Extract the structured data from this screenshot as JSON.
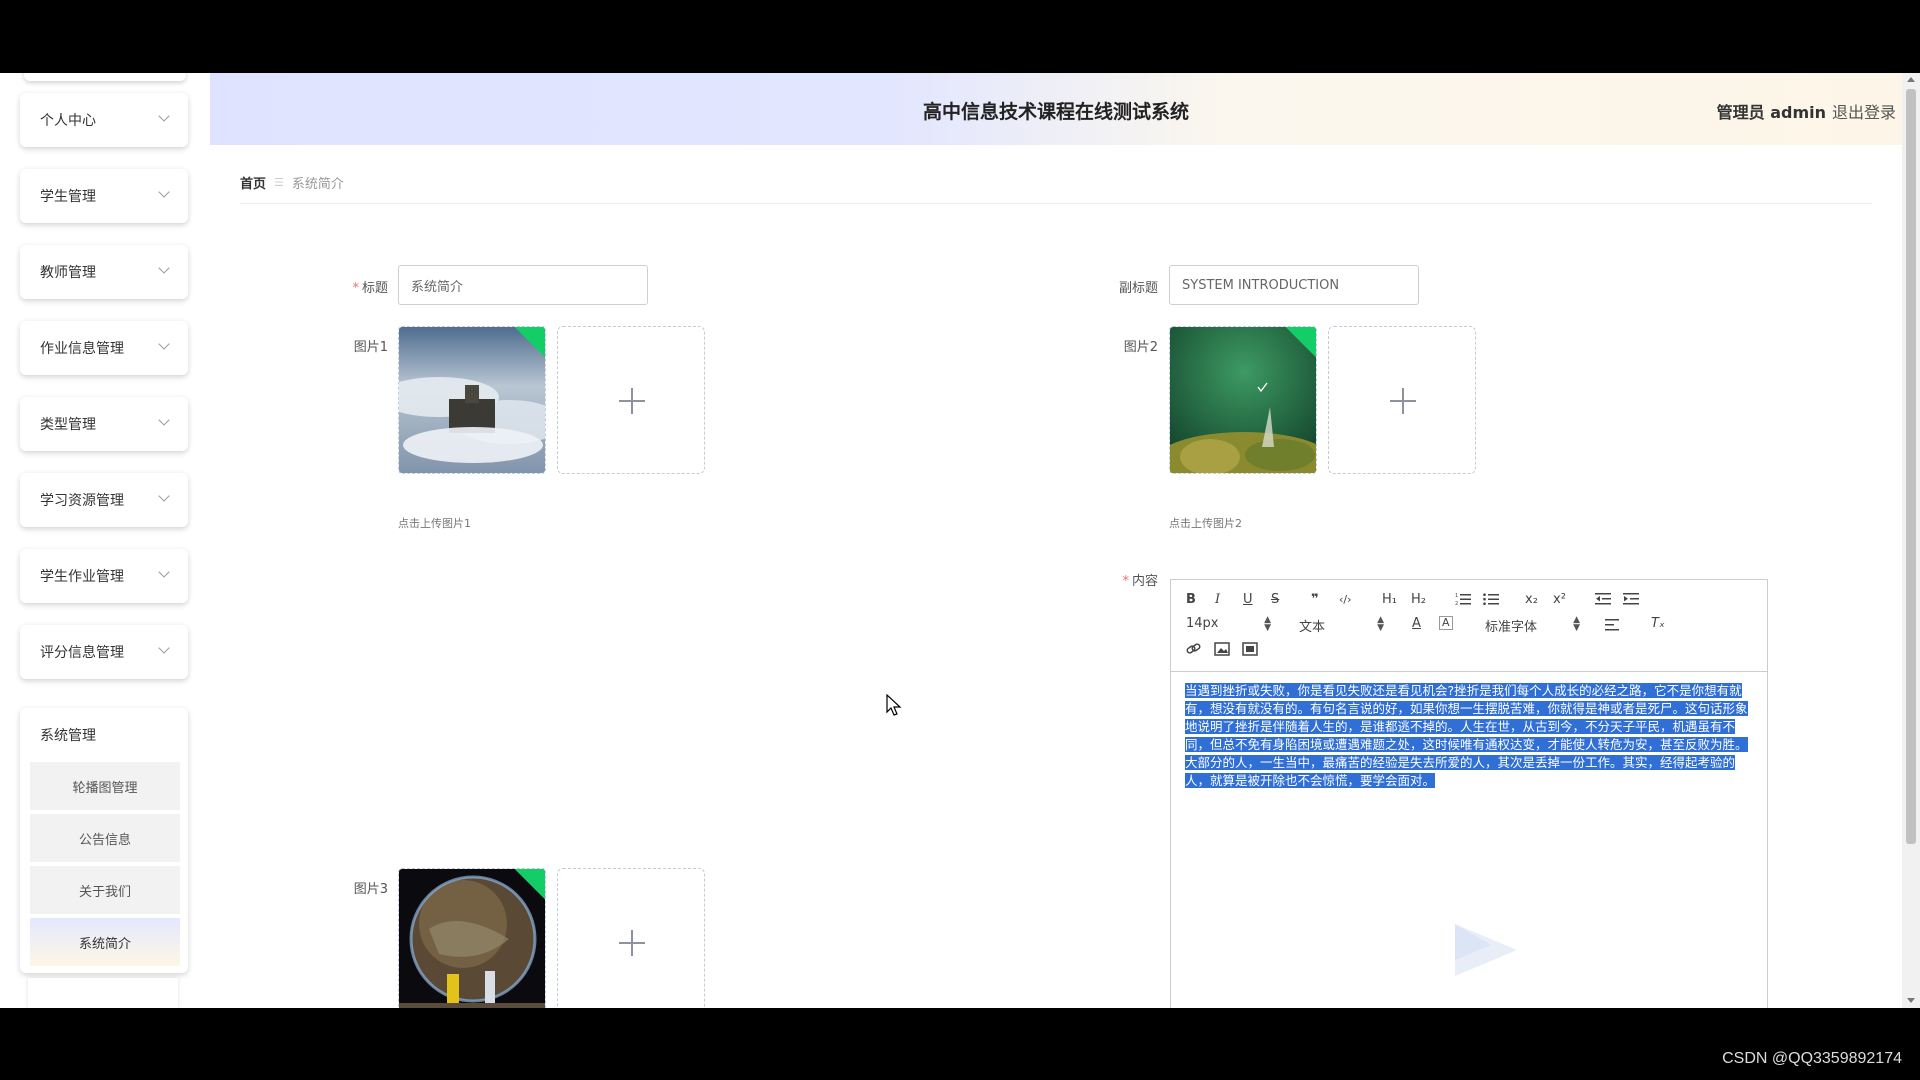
{
  "app": {
    "title": "高中信息技术课程在线测试系统",
    "user_label": "管理员 admin",
    "logout_label": "退出登录"
  },
  "sidebar": {
    "items": [
      {
        "label": "个人中心"
      },
      {
        "label": "学生管理"
      },
      {
        "label": "教师管理"
      },
      {
        "label": "作业信息管理"
      },
      {
        "label": "类型管理"
      },
      {
        "label": "学习资源管理"
      },
      {
        "label": "学生作业管理"
      },
      {
        "label": "评分信息管理"
      }
    ],
    "expanded": {
      "label": "系统管理",
      "children": [
        {
          "label": "轮播图管理"
        },
        {
          "label": "公告信息"
        },
        {
          "label": "关于我们"
        },
        {
          "label": "系统简介",
          "active": true
        }
      ]
    }
  },
  "breadcrumb": {
    "home": "首页",
    "separator": "☰",
    "current": "系统简介"
  },
  "form": {
    "title_label": "标题",
    "title_value": "系统简介",
    "subtitle_label": "副标题",
    "subtitle_value": "SYSTEM INTRODUCTION",
    "pic1_label": "图片1",
    "pic1_hint": "点击上传图片1",
    "pic2_label": "图片2",
    "pic2_hint": "点击上传图片2",
    "pic3_label": "图片3",
    "content_label": "内容",
    "required_mark": "*"
  },
  "editor": {
    "toolbar": {
      "bold": "B",
      "italic": "I",
      "underline": "U",
      "strike": "S",
      "quote": "❞",
      "code": "‹/›",
      "h1": "H₁",
      "h2": "H₂",
      "sub": "x₂",
      "sup": "x²",
      "size": "14px",
      "header": "文本",
      "font": "标准字体",
      "color": "A",
      "clean": "Tₓ"
    },
    "content": "当遇到挫折或失败，你是看见失败还是看见机会?挫折是我们每个人成长的必经之路，它不是你想有就有，想没有就没有的。有句名言说的好，如果你想一生摆脱苦难，你就得是神或者是死尸。这句话形象地说明了挫折是伴随着人生的，是谁都逃不掉的。人生在世，从古到今，不分天子平民，机遇虽有不同，但总不免有身陷困境或遭遇难题之处，这时候唯有通权达变，才能使人转危为安，甚至反败为胜。大部分的人，一生当中，最痛苦的经验是失去所爱的人，其次是丢掉一份工作。其实，经得起考验的人，就算是被开除也不会惊慌，要学会面对。"
  },
  "watermark": "CSDN @QQ3359892174",
  "colors": {
    "accent_green": "#13ce66",
    "selection_blue": "#2f6fd6",
    "required_red": "#f56c6c"
  }
}
